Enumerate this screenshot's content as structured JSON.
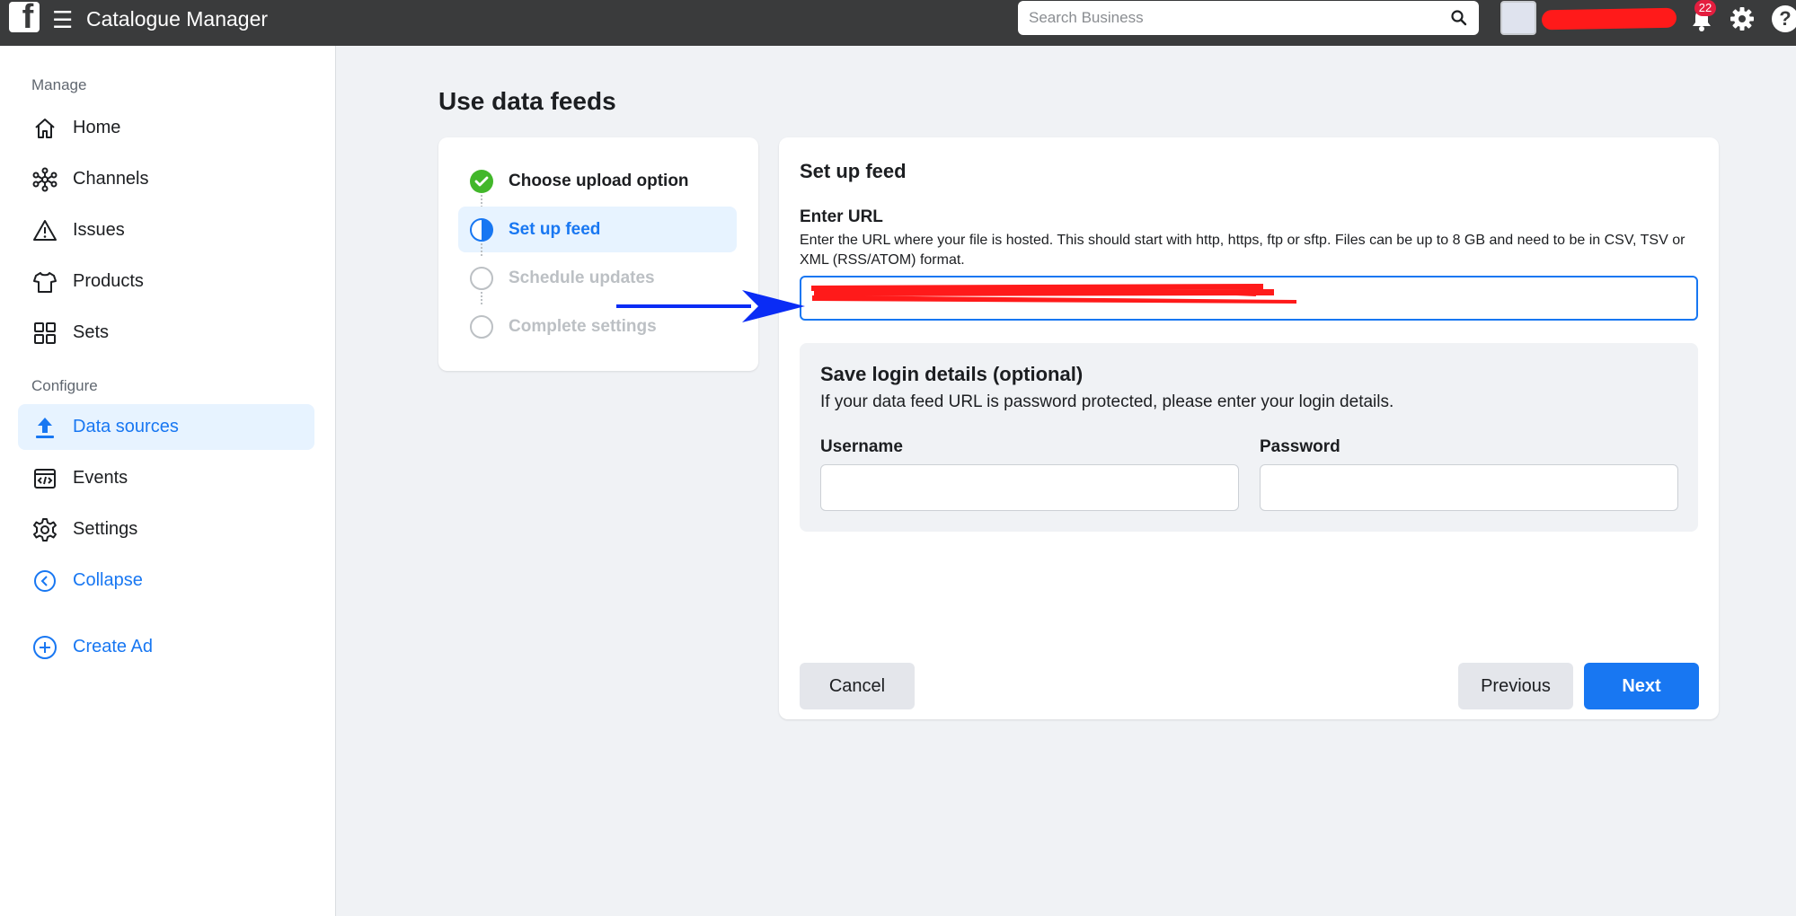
{
  "topbar": {
    "app_title": "Catalogue Manager",
    "search_placeholder": "Search Business",
    "notification_count": "22",
    "help_glyph": "?"
  },
  "sidebar": {
    "manage_label": "Manage",
    "configure_label": "Configure",
    "items": [
      {
        "label": "Home",
        "icon": "home-icon"
      },
      {
        "label": "Channels",
        "icon": "channels-icon"
      },
      {
        "label": "Issues",
        "icon": "warning-icon"
      },
      {
        "label": "Products",
        "icon": "shirt-icon"
      },
      {
        "label": "Sets",
        "icon": "grid-icon"
      },
      {
        "label": "Data sources",
        "icon": "upload-icon",
        "active": true
      },
      {
        "label": "Events",
        "icon": "code-window-icon"
      },
      {
        "label": "Settings",
        "icon": "gear-icon"
      }
    ],
    "collapse_label": "Collapse",
    "create_ad_label": "Create Ad"
  },
  "main": {
    "page_title": "Use data feeds",
    "steps": [
      {
        "label": "Choose upload option",
        "state": "complete"
      },
      {
        "label": "Set up feed",
        "state": "active"
      },
      {
        "label": "Schedule updates",
        "state": "pending"
      },
      {
        "label": "Complete settings",
        "state": "pending"
      }
    ],
    "feed": {
      "heading": "Set up feed",
      "url_label": "Enter URL",
      "url_help": "Enter the URL where your file is hosted. This should start with http, https, ftp or sftp. Files can be up to 8 GB and need to be in CSV, TSV or XML (RSS/ATOM) format.",
      "url_value": "",
      "login": {
        "title": "Save login details (optional)",
        "description": "If your data feed URL is password protected, please enter your login details.",
        "username_label": "Username",
        "password_label": "Password",
        "username_value": "",
        "password_value": ""
      },
      "buttons": {
        "cancel": "Cancel",
        "previous": "Previous",
        "next": "Next"
      }
    }
  },
  "colors": {
    "accent": "#1877f2",
    "topbar": "#3a3b3c",
    "success": "#42b72a",
    "redaction": "#ff1a1a",
    "annotation_arrow": "#0a2cf5"
  }
}
